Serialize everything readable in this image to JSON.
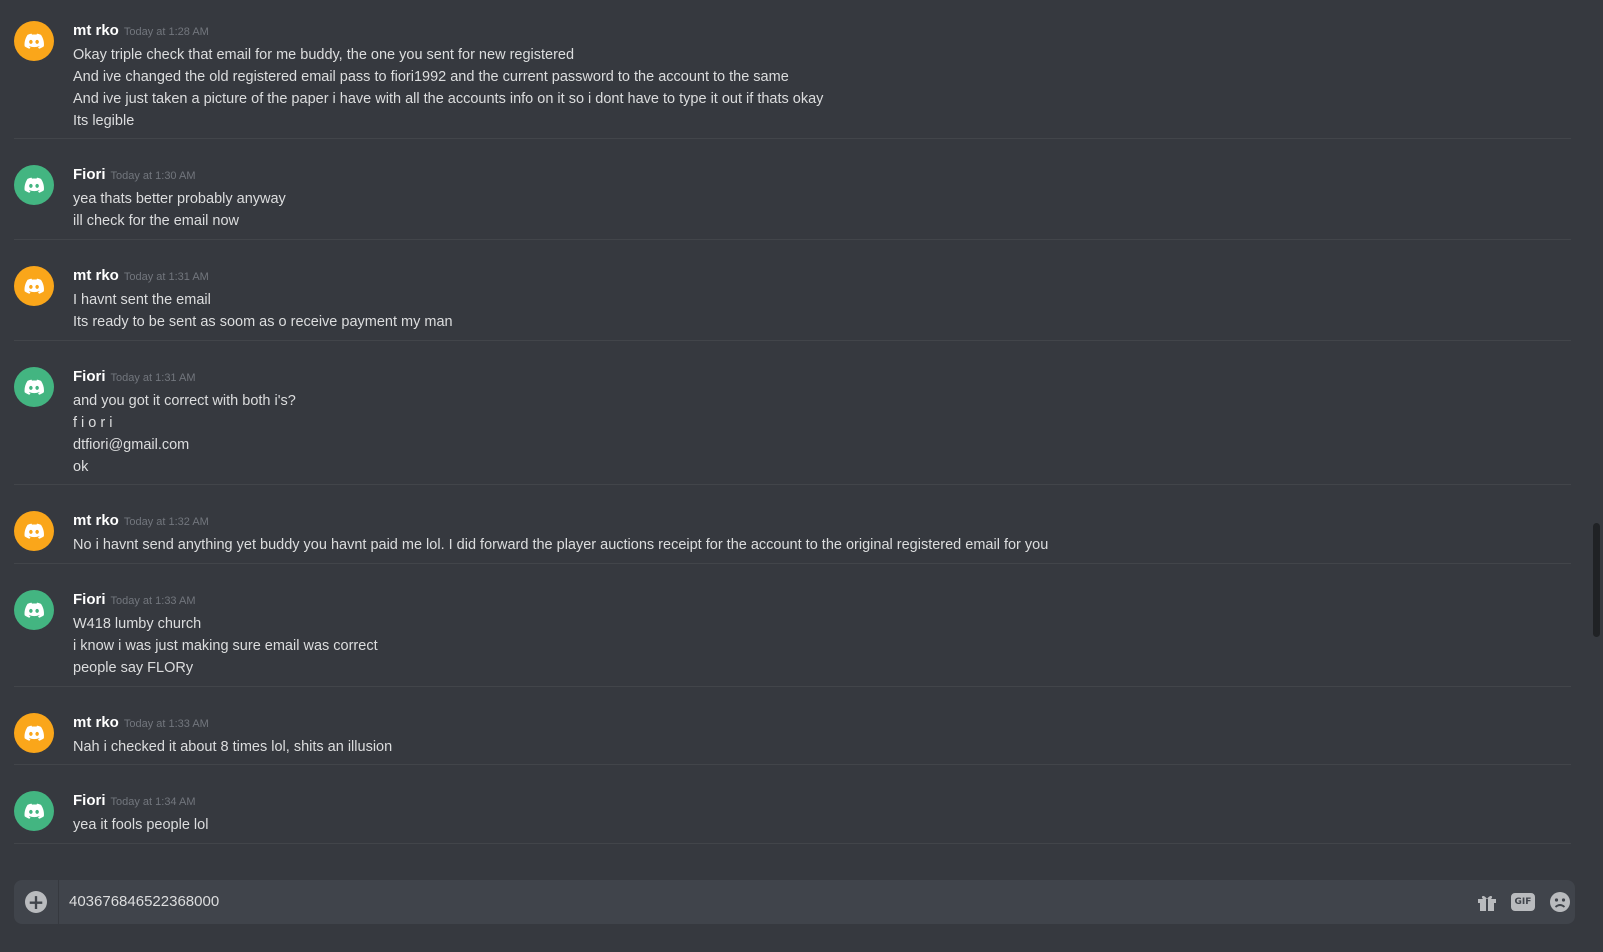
{
  "messages": [
    {
      "author": "mt rko",
      "timestamp": "Today at 1:28 AM",
      "avatar_color": "#faa61a",
      "lines": [
        "Okay triple check that email for me buddy, the one you sent for new registered",
        "And ive changed the old registered email pass to fiori1992 and the current password to the account to the same",
        "And ive just taken a picture of the paper i have with all the accounts info on it so i dont have to type it out if thats okay",
        "Its legible"
      ]
    },
    {
      "author": "Fiori",
      "timestamp": "Today at 1:30 AM",
      "avatar_color": "#43b581",
      "lines": [
        "yea thats better probably anyway",
        "ill check for the email now"
      ]
    },
    {
      "author": "mt rko",
      "timestamp": "Today at 1:31 AM",
      "avatar_color": "#faa61a",
      "lines": [
        "I havnt sent the email",
        "Its ready to be sent as soom as o receive payment my man"
      ]
    },
    {
      "author": "Fiori",
      "timestamp": "Today at 1:31 AM",
      "avatar_color": "#43b581",
      "lines": [
        "and you got it correct with both i's?",
        "f i o r i",
        "dtfiori@gmail.com",
        "ok"
      ]
    },
    {
      "author": "mt rko",
      "timestamp": "Today at 1:32 AM",
      "avatar_color": "#faa61a",
      "lines": [
        "No i havnt send anything yet buddy you havnt paid me lol. I did forward the player auctions receipt for the account to the original registered email for you"
      ]
    },
    {
      "author": "Fiori",
      "timestamp": "Today at 1:33 AM",
      "avatar_color": "#43b581",
      "lines": [
        "W418 lumby church",
        "i know i was just making sure email was correct",
        "people say FLORy"
      ]
    },
    {
      "author": "mt rko",
      "timestamp": "Today at 1:33 AM",
      "avatar_color": "#faa61a",
      "lines": [
        "Nah i checked it about 8 times lol, shits an illusion"
      ]
    },
    {
      "author": "Fiori",
      "timestamp": "Today at 1:34 AM",
      "avatar_color": "#43b581",
      "lines": [
        "yea it fools people lol"
      ]
    }
  ],
  "composer": {
    "value": "403676846522368000",
    "icons": [
      "plus-icon",
      "gift-icon",
      "gif-icon",
      "emoji-icon"
    ],
    "gif_label": "GIF"
  }
}
